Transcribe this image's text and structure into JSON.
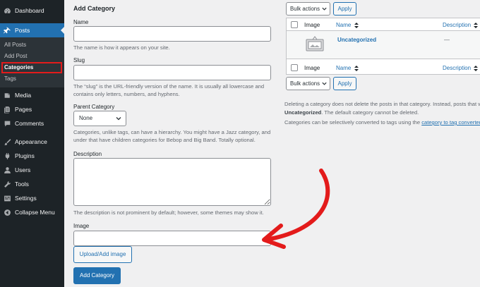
{
  "sidebar": {
    "items": [
      {
        "label": "Dashboard",
        "icon": "dashboard-icon"
      },
      {
        "label": "Posts",
        "icon": "pin-icon",
        "current": true
      },
      {
        "label": "Media",
        "icon": "media-icon"
      },
      {
        "label": "Pages",
        "icon": "pages-icon"
      },
      {
        "label": "Comments",
        "icon": "comment-icon"
      },
      {
        "label": "Appearance",
        "icon": "paintbrush-icon"
      },
      {
        "label": "Plugins",
        "icon": "plugin-icon"
      },
      {
        "label": "Users",
        "icon": "users-icon"
      },
      {
        "label": "Tools",
        "icon": "wrench-icon"
      },
      {
        "label": "Settings",
        "icon": "settings-icon"
      },
      {
        "label": "Collapse Menu",
        "icon": "collapse-icon"
      }
    ],
    "submenu": [
      "All Posts",
      "Add Post",
      "Categories",
      "Tags"
    ]
  },
  "form": {
    "title": "Add Category",
    "name_label": "Name",
    "name_value": "",
    "name_help": "The name is how it appears on your site.",
    "slug_label": "Slug",
    "slug_value": "",
    "slug_help_1": "The “slug” is the URL-friendly version of the name. It is usually all lowercase and",
    "slug_help_2": "contains only letters, numbers, and hyphens.",
    "parent_label": "Parent Category",
    "parent_value": "None",
    "parent_help_1": "Categories, unlike tags, can have a hierarchy. You might have a Jazz category, and",
    "parent_help_2": "under that have children categories for Bebop and Big Band. Totally optional.",
    "description_label": "Description",
    "description_value": "",
    "description_help": "The description is not prominent by default; however, some themes may show it.",
    "image_label": "Image",
    "image_value": "",
    "upload_button": "Upload/Add image",
    "submit_button": "Add Category"
  },
  "list": {
    "bulk_actions": "Bulk actions",
    "apply": "Apply",
    "columns": {
      "image": "Image",
      "name": "Name",
      "description": "Description"
    },
    "rows": [
      {
        "name": "Uncategorized",
        "description": "—"
      }
    ],
    "notes": {
      "line1": "Deleting a category does not delete the posts in that category. Instead, posts that w",
      "line2_bold": "Uncategorized",
      "line2_rest": ". The default category cannot be deleted.",
      "line3_pre": "Categories can be selectively converted to tags using the ",
      "line3_link": "category to tag converter",
      "line3_post": "."
    }
  },
  "colors": {
    "sidebar_bg": "#1d2327",
    "accent": "#2271b1",
    "highlight_box": "#e31b1b",
    "arrow": "#e31b1b"
  }
}
